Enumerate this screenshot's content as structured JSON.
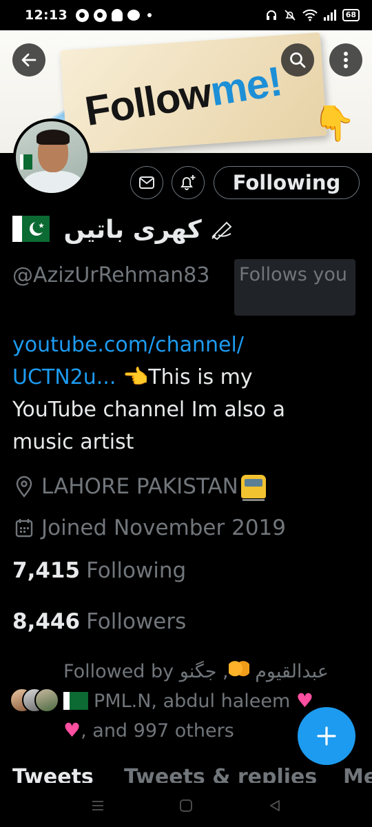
{
  "status_bar": {
    "time": "12:13",
    "battery": "68",
    "left_icons": [
      "whatsapp-icon",
      "messenger-icon",
      "snapchat-icon",
      "chat-bubble-icon"
    ],
    "right_icons": [
      "headset-icon",
      "bell-muted-icon",
      "wifi-icon",
      "signal-icon",
      "battery-icon"
    ]
  },
  "banner": {
    "sign_word_dark": "Follow",
    "sign_word_accent": "me!",
    "accent_color": "#1d8fd6"
  },
  "header_actions": {
    "back": "back-arrow-icon",
    "search": "search-icon",
    "more": "more-vertical-icon"
  },
  "profile": {
    "display_name": "کھری باتیں",
    "handle": "@AzizUrRehman83",
    "follows_you_badge": "Follows you",
    "following_button": "Following",
    "bio_link": "youtube.com/channel/UCTN2u...",
    "bio_link_line1": "youtube.com/channel/",
    "bio_link_line2": "UCTN2u...",
    "bio_text": "This is my YouTube channel Im also a music artist",
    "bio_text_line1": "This is my",
    "bio_text_line2": "YouTube channel Im also a",
    "bio_text_line3": "music artist",
    "location": "LAHORE PAKISTAN",
    "joined": "Joined November 2019",
    "following_count": "7,415",
    "following_label": "Following",
    "followers_count": "8,446",
    "followers_label": "Followers",
    "followed_by_prefix": "Followed by",
    "followed_by_name_1": "عبدالقیوم",
    "followed_by_name_2": "جگنو",
    "followed_by_name_3": "PML.N, abdul haleem",
    "followed_by_suffix": ", and 997 others",
    "link_color": "#1d9bf0"
  },
  "tabs": [
    {
      "label": "Tweets"
    },
    {
      "label": "Tweets & replies"
    },
    {
      "label": "Media"
    }
  ],
  "fab": {
    "icon": "plus-icon"
  },
  "nav_bar": {
    "buttons": [
      "recent-apps-icon",
      "home-icon",
      "back-triangle-icon"
    ]
  }
}
